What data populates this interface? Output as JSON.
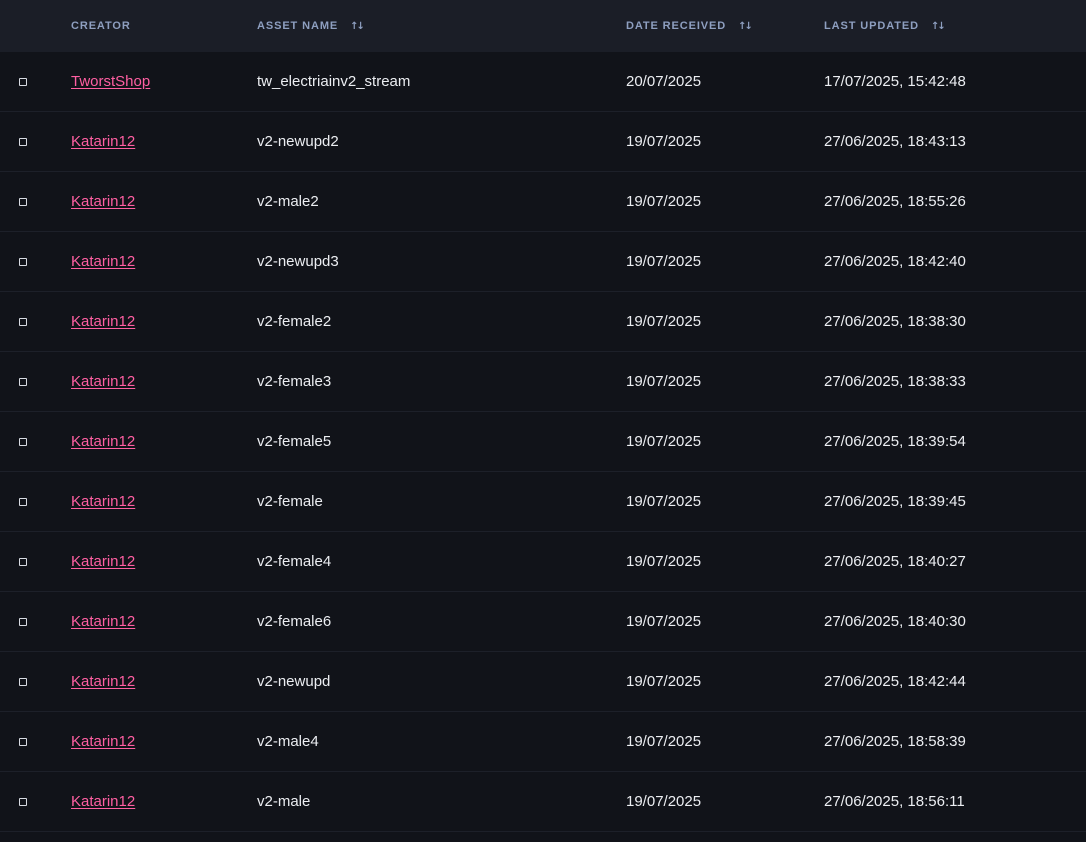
{
  "table": {
    "columns": {
      "creator": "CREATOR",
      "asset_name": "ASSET NAME",
      "date_received": "DATE RECEIVED",
      "last_updated": "LAST UPDATED"
    },
    "sort_icon": "sort-arrows-icon",
    "rows": [
      {
        "creator": "TworstShop",
        "asset_name": "tw_electriainv2_stream",
        "date_received": "20/07/2025",
        "last_updated": "17/07/2025, 15:42:48"
      },
      {
        "creator": "Katarin12",
        "asset_name": "v2-newupd2",
        "date_received": "19/07/2025",
        "last_updated": "27/06/2025, 18:43:13"
      },
      {
        "creator": "Katarin12",
        "asset_name": "v2-male2",
        "date_received": "19/07/2025",
        "last_updated": "27/06/2025, 18:55:26"
      },
      {
        "creator": "Katarin12",
        "asset_name": "v2-newupd3",
        "date_received": "19/07/2025",
        "last_updated": "27/06/2025, 18:42:40"
      },
      {
        "creator": "Katarin12",
        "asset_name": "v2-female2",
        "date_received": "19/07/2025",
        "last_updated": "27/06/2025, 18:38:30"
      },
      {
        "creator": "Katarin12",
        "asset_name": "v2-female3",
        "date_received": "19/07/2025",
        "last_updated": "27/06/2025, 18:38:33"
      },
      {
        "creator": "Katarin12",
        "asset_name": "v2-female5",
        "date_received": "19/07/2025",
        "last_updated": "27/06/2025, 18:39:54"
      },
      {
        "creator": "Katarin12",
        "asset_name": "v2-female",
        "date_received": "19/07/2025",
        "last_updated": "27/06/2025, 18:39:45"
      },
      {
        "creator": "Katarin12",
        "asset_name": "v2-female4",
        "date_received": "19/07/2025",
        "last_updated": "27/06/2025, 18:40:27"
      },
      {
        "creator": "Katarin12",
        "asset_name": "v2-female6",
        "date_received": "19/07/2025",
        "last_updated": "27/06/2025, 18:40:30"
      },
      {
        "creator": "Katarin12",
        "asset_name": "v2-newupd",
        "date_received": "19/07/2025",
        "last_updated": "27/06/2025, 18:42:44"
      },
      {
        "creator": "Katarin12",
        "asset_name": "v2-male4",
        "date_received": "19/07/2025",
        "last_updated": "27/06/2025, 18:58:39"
      },
      {
        "creator": "Katarin12",
        "asset_name": "v2-male",
        "date_received": "19/07/2025",
        "last_updated": "27/06/2025, 18:56:11"
      }
    ]
  }
}
